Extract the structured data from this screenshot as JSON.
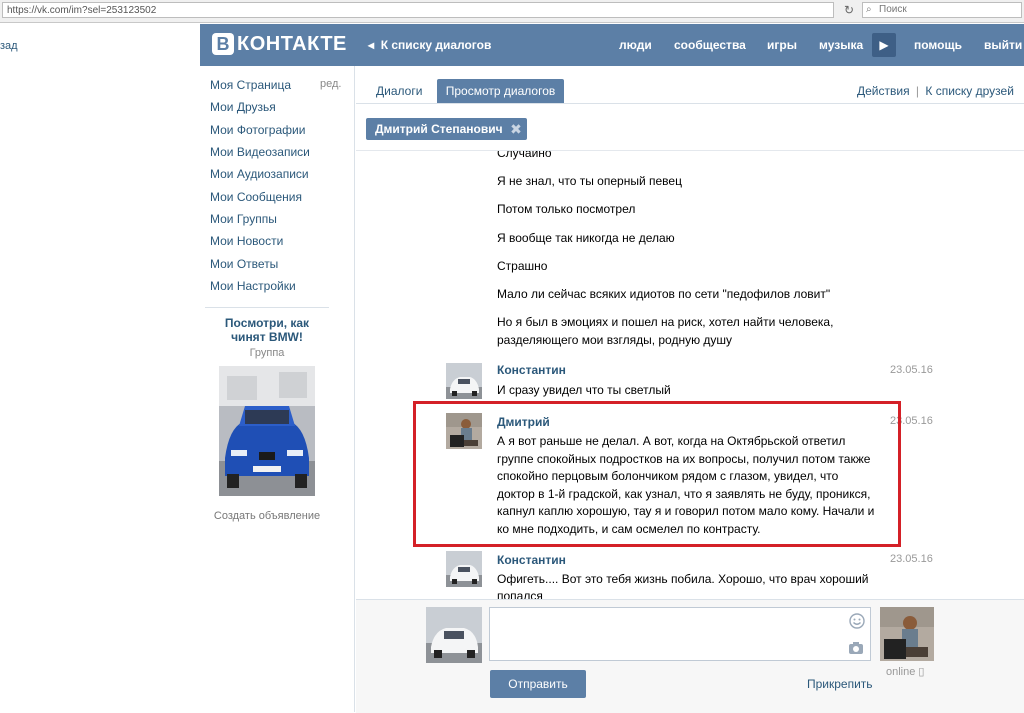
{
  "browser": {
    "url": "https://vk.com/im?sel=253123502",
    "search_placeholder": "Поиск"
  },
  "left_partial": {
    "text": "зад"
  },
  "header": {
    "logo_letter": "В",
    "logo_text": "КОНТАКТЕ",
    "back_link": "К списку диалогов",
    "nav": [
      "люди",
      "сообщества",
      "игры",
      "музыка",
      "помощь",
      "выйти"
    ]
  },
  "sidebar": {
    "items": [
      "Моя Страница",
      "Мои Друзья",
      "Мои Фотографии",
      "Мои Видеозаписи",
      "Мои Аудиозаписи",
      "Мои Сообщения",
      "Мои Группы",
      "Мои Новости",
      "Мои Ответы",
      "Мои Настройки"
    ],
    "edit_label": "ред.",
    "ad": {
      "title": "Посмотри, как чинят BMW!",
      "subtitle": "Группа",
      "create_label": "Создать объявление"
    }
  },
  "tabs": {
    "dialogs": "Диалоги",
    "view": "Просмотр диалогов",
    "actions": "Действия",
    "separator": "|",
    "friends": "К списку друзей"
  },
  "chip": {
    "name": "Дмитрий Степанович"
  },
  "messages": {
    "m0": "Случайно",
    "m1": "Я не знал, что ты оперный певец",
    "m2": "Потом только посмотрел",
    "m3": "Я вообще так никогда не делаю",
    "m4": "Страшно",
    "m5": "Мало ли сейчас всяких идиотов по сети \"педофилов ловит\"",
    "m6a": "Но я был в эмоциях и пошел на риск, хотел найти человека,",
    "m6b": "разделяющего мои взгляды, родную душу",
    "k1_author": "Константин",
    "k1_date": "23.05.16",
    "k1_text": "И сразу увидел что ты светлый",
    "d_author": "Дмитрий",
    "d_date": "23.05.16",
    "d_lines": [
      "А я вот раньше не делал. А вот, когда на Октябрьской ответил",
      "группе спокойных подростков на их вопросы, получил потом также",
      "спокойно перцовым болончиком рядом с глазом, увидел, что",
      "доктор в 1-й градской, как узнал, что я заявлять не буду, проникся,",
      "капнул каплю хорошую, тау я и говорил потом мало кому. Начали и",
      "ко мне подходить, и сам осмелел по контрасту."
    ],
    "k2_author": "Константин",
    "k2_date": "23.05.16",
    "k2_line1": "Офигеть.... Вот это тебя жизнь побила. Хорошо, что врач хороший",
    "k2_line2": "попался"
  },
  "compose": {
    "send_label": "Отправить",
    "attach_label": "Прикрепить",
    "status": "online"
  },
  "colors": {
    "vk_blue": "#5c7fa6",
    "link": "#2b587a",
    "highlight": "#d42027"
  },
  "icons": [
    "search-icon",
    "reload-icon",
    "play-icon",
    "close-icon",
    "smile-icon",
    "camera-icon",
    "mobile-icon"
  ]
}
